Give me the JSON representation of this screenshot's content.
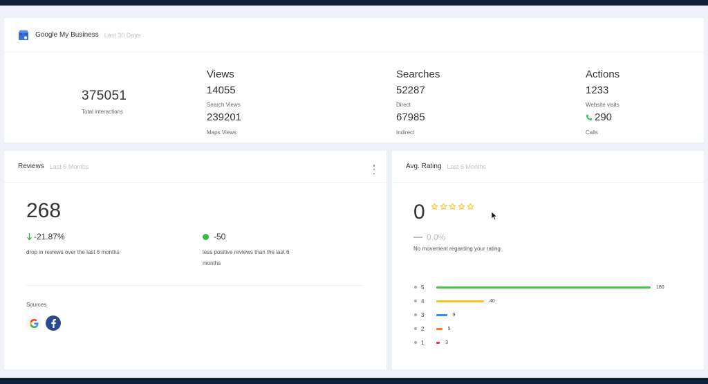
{
  "gmb": {
    "title": "Google My Business",
    "subtitle": "Last 30 Days",
    "total": {
      "value": "375051",
      "label": "Total interactions"
    },
    "views": {
      "title": "Views",
      "search_value": "14055",
      "search_label": "Search Views",
      "maps_value": "239201",
      "maps_label": "Maps Views"
    },
    "searches": {
      "title": "Searches",
      "direct_value": "52287",
      "direct_label": "Direct",
      "indirect_value": "67985",
      "indirect_label": "Indirect"
    },
    "actions": {
      "title": "Actions",
      "website_value": "1233",
      "website_label": "Website visits",
      "calls_value": "290",
      "calls_label": "Calls"
    }
  },
  "reviews": {
    "title": "Reviews",
    "subtitle": "Last 6 Months",
    "count": "268",
    "drop_value": "-21.87%",
    "drop_text": "drop in reviews over the last 6 months",
    "positive_value": "-50",
    "positive_text": "less positive reviews than the last 6 months",
    "sources_label": "Sources",
    "sources": [
      "google-icon",
      "facebook-icon"
    ]
  },
  "rating": {
    "title": "Avg. Rating",
    "subtitle": "Last 6 Months",
    "value": "0",
    "stars": 5,
    "change_value": "0.0%",
    "change_text": "No movement regarding your rating.",
    "distribution": [
      {
        "label": "5",
        "count": 180,
        "color": "#4cc24c"
      },
      {
        "label": "4",
        "count": 40,
        "color": "#f5c518"
      },
      {
        "label": "3",
        "count": 9,
        "color": "#2d8fe6"
      },
      {
        "label": "2",
        "count": 5,
        "color": "#f07a2a"
      },
      {
        "label": "1",
        "count": 3,
        "color": "#e53935"
      }
    ]
  },
  "colors": {
    "accent_green": "#2fbf4a",
    "arrow_green": "#39a845",
    "phone_green": "#3cc46a",
    "star_yellow": "#f5c518",
    "facebook_blue": "#2b4a8b"
  }
}
